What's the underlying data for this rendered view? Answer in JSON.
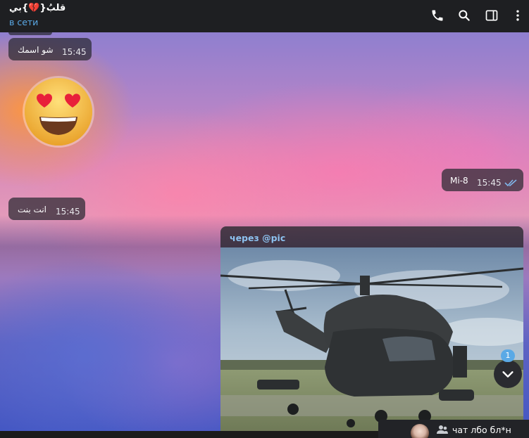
{
  "header": {
    "chat_title": "قلبُ{💔}بي",
    "status": "в сети",
    "call_icon": "phone-icon",
    "search_icon": "search-icon",
    "side_panel_icon": "sidebar-toggle-icon"
  },
  "messages": [
    {
      "direction": "incoming",
      "text": "شو اسمك",
      "time": "15:45"
    },
    {
      "direction": "incoming",
      "type": "sticker",
      "emoji": "heart-eyes-emoji"
    },
    {
      "direction": "outgoing",
      "text": "Mi-8",
      "time": "15:45",
      "read": true
    },
    {
      "direction": "incoming",
      "text": "انت بنت",
      "time": "15:45"
    },
    {
      "direction": "outgoing",
      "type": "photo",
      "via": "через @pic",
      "photo_subject": "helicopter"
    }
  ],
  "scroll_button": {
    "icon": "chevron-down-icon",
    "unread_count": "1"
  },
  "group_tab": {
    "name": "чат лбо бл*н",
    "icon": "group-icon"
  },
  "colors": {
    "accent": "#5aa9e6",
    "header_bg": "#1e1f22",
    "bubble_bg": "#28282f"
  }
}
